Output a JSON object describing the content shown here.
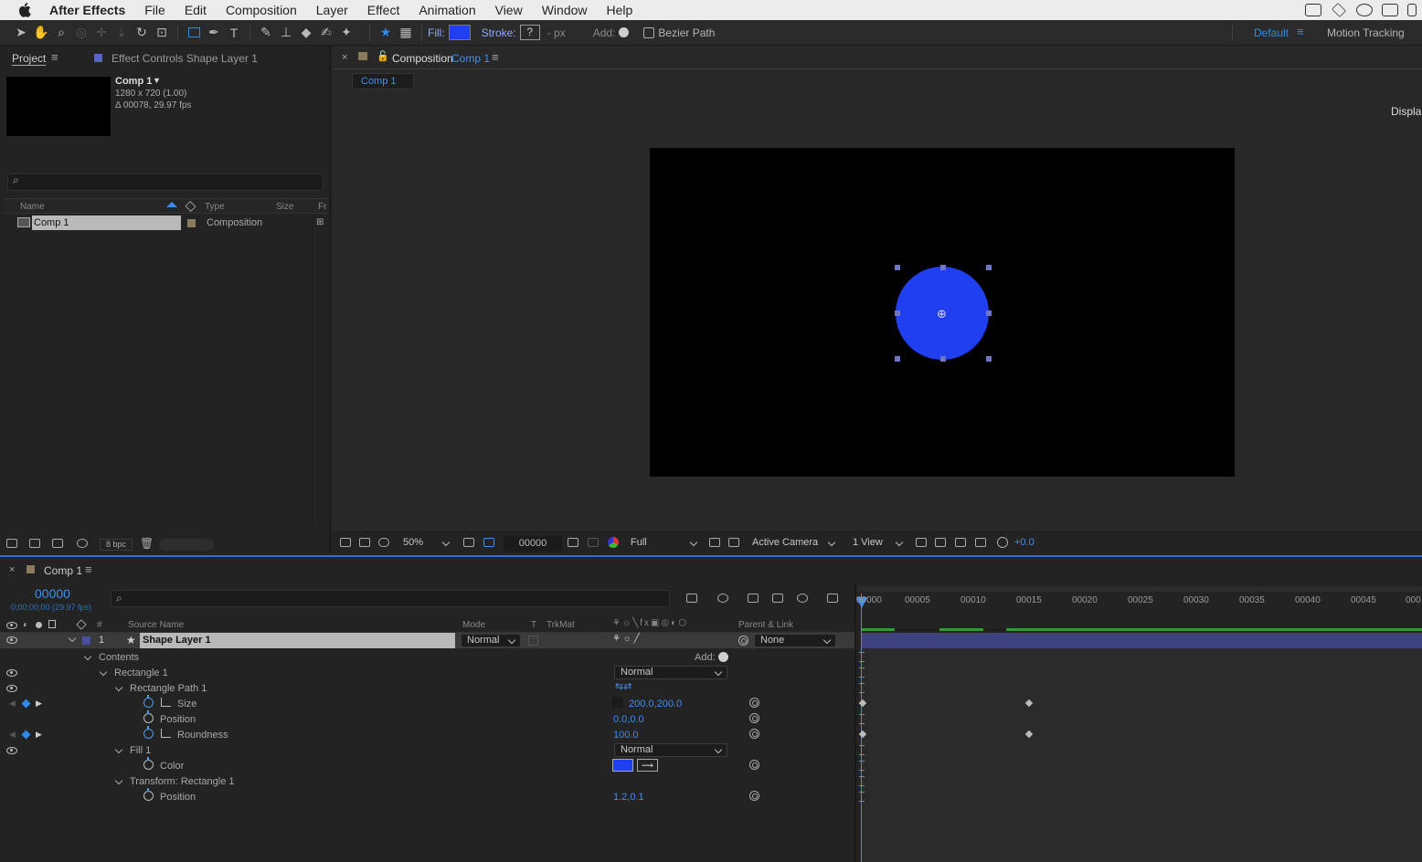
{
  "menubar": {
    "app": "After Effects",
    "items": [
      "File",
      "Edit",
      "Composition",
      "Layer",
      "Effect",
      "Animation",
      "View",
      "Window",
      "Help"
    ]
  },
  "toolbar": {
    "fill_label": "Fill:",
    "stroke_label": "Stroke:",
    "stroke_value": "?",
    "px_label": "- px",
    "add_label": "Add:",
    "bezier_label": "Bezier Path",
    "workspace_default": "Default",
    "workspace_motion": "Motion Tracking",
    "fill_color": "#1f3ff0"
  },
  "project": {
    "tab_project": "Project",
    "tab_effect": "Effect Controls Shape Layer 1",
    "comp_name": "Comp 1",
    "comp_dims": "1280 x 720 (1.00)",
    "comp_dur": "Δ 00078, 29.97 fps",
    "search_placeholder": "⌕",
    "cols": {
      "name": "Name",
      "type": "Type",
      "size": "Size",
      "fr": "Fr"
    },
    "item_name": "Comp 1",
    "item_type": "Composition",
    "bpc": "8 bpc"
  },
  "viewer": {
    "tab_prefix": "Composition",
    "tab_comp": "Comp 1",
    "crumb": "Comp 1",
    "display_text": "Displa",
    "zoom": "50%",
    "timecode": "00000",
    "resolution": "Full",
    "camera": "Active Camera",
    "views": "1 View",
    "exposure": "+0.0",
    "circle_color": "#1f3ff0"
  },
  "timeline": {
    "tab": "Comp 1",
    "timecode": "00000",
    "timecode_sub": "0;00;00;00 (29.97 fps)",
    "cols": {
      "source": "Source Name",
      "mode": "Mode",
      "t": "T",
      "trkmat": "TrkMat",
      "parent": "Parent & Link"
    },
    "layer": {
      "num": "1",
      "name": "Shape Layer 1",
      "mode": "Normal",
      "parent": "None"
    },
    "contents": "Contents",
    "add_label": "Add:",
    "rect1": "Rectangle 1",
    "rect1_mode": "Normal",
    "rect_path": "Rectangle Path 1",
    "size_label": "Size",
    "size_value": "200.0,200.0",
    "position_label": "Position",
    "position_value": "0.0,0.0",
    "roundness_label": "Roundness",
    "roundness_value": "100.0",
    "fill1": "Fill 1",
    "fill1_mode": "Normal",
    "color_label": "Color",
    "transform": "Transform: Rectangle 1",
    "tposition_label": "Position",
    "tposition_value": "1.2,0.1",
    "ticks": [
      "00000",
      "00005",
      "00010",
      "00015",
      "00020",
      "00025",
      "00030",
      "00035",
      "00040",
      "00045",
      "000"
    ]
  }
}
